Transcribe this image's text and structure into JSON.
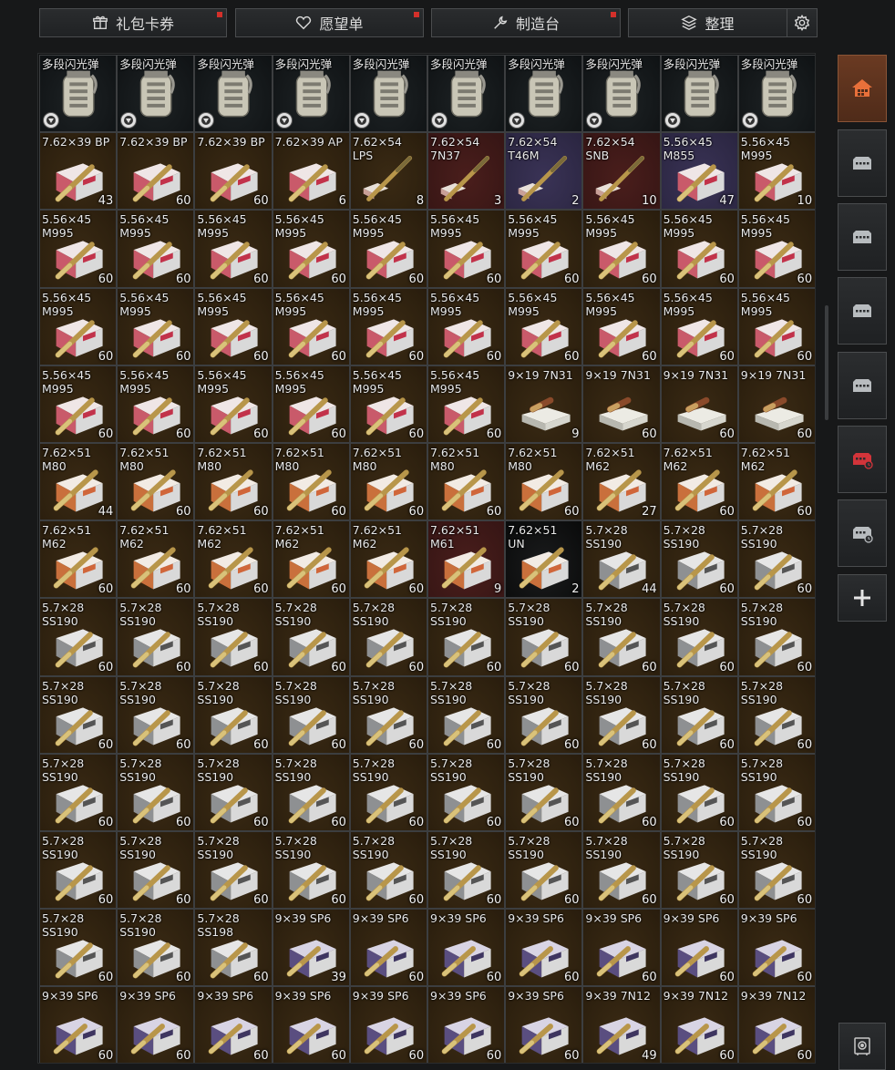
{
  "toolbar": {
    "gift_label": "礼包卡券",
    "wishlist_label": "愿望单",
    "crafting_label": "制造台",
    "sort_label": "整理"
  },
  "colors": {
    "accent_active": "#6a3a22",
    "notify_dot": "#d3302a",
    "cell_default": "#2e210f",
    "cell_red": "#351514",
    "cell_purple": "#2a2540",
    "cell_black": "#090a0a"
  },
  "sidebar": {
    "items": [
      "home-icon",
      "container-icon",
      "container-icon",
      "container-icon",
      "container-icon",
      "red-container-icon",
      "timed-container-icon",
      "plus-icon"
    ],
    "bottom": "safe-icon"
  },
  "stash_rows": [
    [
      {
        "name": "多段闪光弹",
        "count": "",
        "bg": "dark",
        "art": "grenade"
      },
      {
        "name": "多段闪光弹",
        "count": "",
        "bg": "dark",
        "art": "grenade"
      },
      {
        "name": "多段闪光弹",
        "count": "",
        "bg": "dark",
        "art": "grenade"
      },
      {
        "name": "多段闪光弹",
        "count": "",
        "bg": "dark",
        "art": "grenade"
      },
      {
        "name": "多段闪光弹",
        "count": "",
        "bg": "dark",
        "art": "grenade"
      },
      {
        "name": "多段闪光弹",
        "count": "",
        "bg": "dark",
        "art": "grenade"
      },
      {
        "name": "多段闪光弹",
        "count": "",
        "bg": "dark",
        "art": "grenade"
      },
      {
        "name": "多段闪光弹",
        "count": "",
        "bg": "dark",
        "art": "grenade"
      },
      {
        "name": "多段闪光弹",
        "count": "",
        "bg": "dark",
        "art": "grenade"
      },
      {
        "name": "多段闪光弹",
        "count": "",
        "bg": "dark",
        "art": "grenade"
      }
    ],
    [
      {
        "name": "7.62×39 BP",
        "count": "43",
        "bg": "default",
        "art": "ammo-pink"
      },
      {
        "name": "7.62×39 BP",
        "count": "60",
        "bg": "default",
        "art": "ammo-pink"
      },
      {
        "name": "7.62×39 BP",
        "count": "60",
        "bg": "default",
        "art": "ammo-pink"
      },
      {
        "name": "7.62×39 AP",
        "count": "6",
        "bg": "default",
        "art": "ammo-pink"
      },
      {
        "name": "7.62×54\nLPS",
        "count": "8",
        "bg": "default",
        "art": "rifle-round"
      },
      {
        "name": "7.62×54\n7N37",
        "count": "3",
        "bg": "red",
        "art": "rifle-round"
      },
      {
        "name": "7.62×54\nT46M",
        "count": "2",
        "bg": "purple",
        "art": "rifle-round"
      },
      {
        "name": "7.62×54\nSNB",
        "count": "10",
        "bg": "red",
        "art": "rifle-round"
      },
      {
        "name": "5.56×45\nM855",
        "count": "47",
        "bg": "purple",
        "art": "ammo-pink"
      },
      {
        "name": "5.56×45\nM995",
        "count": "10",
        "bg": "default",
        "art": "ammo-pink"
      }
    ],
    [
      {
        "name": "5.56×45\nM995",
        "count": "60",
        "bg": "default",
        "art": "ammo-pink"
      },
      {
        "name": "5.56×45\nM995",
        "count": "60",
        "bg": "default",
        "art": "ammo-pink"
      },
      {
        "name": "5.56×45\nM995",
        "count": "60",
        "bg": "default",
        "art": "ammo-pink"
      },
      {
        "name": "5.56×45\nM995",
        "count": "60",
        "bg": "default",
        "art": "ammo-pink"
      },
      {
        "name": "5.56×45\nM995",
        "count": "60",
        "bg": "default",
        "art": "ammo-pink"
      },
      {
        "name": "5.56×45\nM995",
        "count": "60",
        "bg": "default",
        "art": "ammo-pink"
      },
      {
        "name": "5.56×45\nM995",
        "count": "60",
        "bg": "default",
        "art": "ammo-pink"
      },
      {
        "name": "5.56×45\nM995",
        "count": "60",
        "bg": "default",
        "art": "ammo-pink"
      },
      {
        "name": "5.56×45\nM995",
        "count": "60",
        "bg": "default",
        "art": "ammo-pink"
      },
      {
        "name": "5.56×45\nM995",
        "count": "60",
        "bg": "default",
        "art": "ammo-pink"
      }
    ],
    [
      {
        "name": "5.56×45\nM995",
        "count": "60",
        "bg": "default",
        "art": "ammo-pink"
      },
      {
        "name": "5.56×45\nM995",
        "count": "60",
        "bg": "default",
        "art": "ammo-pink"
      },
      {
        "name": "5.56×45\nM995",
        "count": "60",
        "bg": "default",
        "art": "ammo-pink"
      },
      {
        "name": "5.56×45\nM995",
        "count": "60",
        "bg": "default",
        "art": "ammo-pink"
      },
      {
        "name": "5.56×45\nM995",
        "count": "60",
        "bg": "default",
        "art": "ammo-pink"
      },
      {
        "name": "5.56×45\nM995",
        "count": "60",
        "bg": "default",
        "art": "ammo-pink"
      },
      {
        "name": "5.56×45\nM995",
        "count": "60",
        "bg": "default",
        "art": "ammo-pink"
      },
      {
        "name": "5.56×45\nM995",
        "count": "60",
        "bg": "default",
        "art": "ammo-pink"
      },
      {
        "name": "5.56×45\nM995",
        "count": "60",
        "bg": "default",
        "art": "ammo-pink"
      },
      {
        "name": "5.56×45\nM995",
        "count": "60",
        "bg": "default",
        "art": "ammo-pink"
      }
    ],
    [
      {
        "name": "5.56×45\nM995",
        "count": "60",
        "bg": "default",
        "art": "ammo-pink"
      },
      {
        "name": "5.56×45\nM995",
        "count": "60",
        "bg": "default",
        "art": "ammo-pink"
      },
      {
        "name": "5.56×45\nM995",
        "count": "60",
        "bg": "default",
        "art": "ammo-pink"
      },
      {
        "name": "5.56×45\nM995",
        "count": "60",
        "bg": "default",
        "art": "ammo-pink"
      },
      {
        "name": "5.56×45\nM995",
        "count": "60",
        "bg": "default",
        "art": "ammo-pink"
      },
      {
        "name": "5.56×45\nM995",
        "count": "60",
        "bg": "default",
        "art": "ammo-pink"
      },
      {
        "name": "9×19 7N31",
        "count": "9",
        "bg": "default",
        "art": "pistol-box"
      },
      {
        "name": "9×19 7N31",
        "count": "60",
        "bg": "default",
        "art": "pistol-box"
      },
      {
        "name": "9×19 7N31",
        "count": "60",
        "bg": "default",
        "art": "pistol-box"
      },
      {
        "name": "9×19 7N31",
        "count": "60",
        "bg": "default",
        "art": "pistol-box"
      }
    ],
    [
      {
        "name": "7.62×51\nM80",
        "count": "44",
        "bg": "default",
        "art": "ammo-orange"
      },
      {
        "name": "7.62×51\nM80",
        "count": "60",
        "bg": "default",
        "art": "ammo-orange"
      },
      {
        "name": "7.62×51\nM80",
        "count": "60",
        "bg": "default",
        "art": "ammo-orange"
      },
      {
        "name": "7.62×51\nM80",
        "count": "60",
        "bg": "default",
        "art": "ammo-orange"
      },
      {
        "name": "7.62×51\nM80",
        "count": "60",
        "bg": "default",
        "art": "ammo-orange"
      },
      {
        "name": "7.62×51\nM80",
        "count": "60",
        "bg": "default",
        "art": "ammo-orange"
      },
      {
        "name": "7.62×51\nM80",
        "count": "60",
        "bg": "default",
        "art": "ammo-orange"
      },
      {
        "name": "7.62×51\nM62",
        "count": "27",
        "bg": "default",
        "art": "ammo-orange"
      },
      {
        "name": "7.62×51\nM62",
        "count": "60",
        "bg": "default",
        "art": "ammo-orange"
      },
      {
        "name": "7.62×51\nM62",
        "count": "60",
        "bg": "default",
        "art": "ammo-orange"
      }
    ],
    [
      {
        "name": "7.62×51\nM62",
        "count": "60",
        "bg": "default",
        "art": "ammo-orange"
      },
      {
        "name": "7.62×51\nM62",
        "count": "60",
        "bg": "default",
        "art": "ammo-orange"
      },
      {
        "name": "7.62×51\nM62",
        "count": "60",
        "bg": "default",
        "art": "ammo-orange"
      },
      {
        "name": "7.62×51\nM62",
        "count": "60",
        "bg": "default",
        "art": "ammo-orange"
      },
      {
        "name": "7.62×51\nM62",
        "count": "60",
        "bg": "default",
        "art": "ammo-orange"
      },
      {
        "name": "7.62×51\nM61",
        "count": "9",
        "bg": "red",
        "art": "ammo-orange"
      },
      {
        "name": "7.62×51\nUN",
        "count": "2",
        "bg": "black",
        "art": "ammo-orange"
      },
      {
        "name": "5.7×28\nSS190",
        "count": "44",
        "bg": "default",
        "art": "ammo-gray"
      },
      {
        "name": "5.7×28\nSS190",
        "count": "60",
        "bg": "default",
        "art": "ammo-gray"
      },
      {
        "name": "5.7×28\nSS190",
        "count": "60",
        "bg": "default",
        "art": "ammo-gray"
      }
    ],
    [
      {
        "name": "5.7×28\nSS190",
        "count": "60",
        "bg": "default",
        "art": "ammo-gray"
      },
      {
        "name": "5.7×28\nSS190",
        "count": "60",
        "bg": "default",
        "art": "ammo-gray"
      },
      {
        "name": "5.7×28\nSS190",
        "count": "60",
        "bg": "default",
        "art": "ammo-gray"
      },
      {
        "name": "5.7×28\nSS190",
        "count": "60",
        "bg": "default",
        "art": "ammo-gray"
      },
      {
        "name": "5.7×28\nSS190",
        "count": "60",
        "bg": "default",
        "art": "ammo-gray"
      },
      {
        "name": "5.7×28\nSS190",
        "count": "60",
        "bg": "default",
        "art": "ammo-gray"
      },
      {
        "name": "5.7×28\nSS190",
        "count": "60",
        "bg": "default",
        "art": "ammo-gray"
      },
      {
        "name": "5.7×28\nSS190",
        "count": "60",
        "bg": "default",
        "art": "ammo-gray"
      },
      {
        "name": "5.7×28\nSS190",
        "count": "60",
        "bg": "default",
        "art": "ammo-gray"
      },
      {
        "name": "5.7×28\nSS190",
        "count": "60",
        "bg": "default",
        "art": "ammo-gray"
      }
    ],
    [
      {
        "name": "5.7×28\nSS190",
        "count": "60",
        "bg": "default",
        "art": "ammo-gray"
      },
      {
        "name": "5.7×28\nSS190",
        "count": "60",
        "bg": "default",
        "art": "ammo-gray"
      },
      {
        "name": "5.7×28\nSS190",
        "count": "60",
        "bg": "default",
        "art": "ammo-gray"
      },
      {
        "name": "5.7×28\nSS190",
        "count": "60",
        "bg": "default",
        "art": "ammo-gray"
      },
      {
        "name": "5.7×28\nSS190",
        "count": "60",
        "bg": "default",
        "art": "ammo-gray"
      },
      {
        "name": "5.7×28\nSS190",
        "count": "60",
        "bg": "default",
        "art": "ammo-gray"
      },
      {
        "name": "5.7×28\nSS190",
        "count": "60",
        "bg": "default",
        "art": "ammo-gray"
      },
      {
        "name": "5.7×28\nSS190",
        "count": "60",
        "bg": "default",
        "art": "ammo-gray"
      },
      {
        "name": "5.7×28\nSS190",
        "count": "60",
        "bg": "default",
        "art": "ammo-gray"
      },
      {
        "name": "5.7×28\nSS190",
        "count": "60",
        "bg": "default",
        "art": "ammo-gray"
      }
    ],
    [
      {
        "name": "5.7×28\nSS190",
        "count": "60",
        "bg": "default",
        "art": "ammo-gray"
      },
      {
        "name": "5.7×28\nSS190",
        "count": "60",
        "bg": "default",
        "art": "ammo-gray"
      },
      {
        "name": "5.7×28\nSS190",
        "count": "60",
        "bg": "default",
        "art": "ammo-gray"
      },
      {
        "name": "5.7×28\nSS190",
        "count": "60",
        "bg": "default",
        "art": "ammo-gray"
      },
      {
        "name": "5.7×28\nSS190",
        "count": "60",
        "bg": "default",
        "art": "ammo-gray"
      },
      {
        "name": "5.7×28\nSS190",
        "count": "60",
        "bg": "default",
        "art": "ammo-gray"
      },
      {
        "name": "5.7×28\nSS190",
        "count": "60",
        "bg": "default",
        "art": "ammo-gray"
      },
      {
        "name": "5.7×28\nSS190",
        "count": "60",
        "bg": "default",
        "art": "ammo-gray"
      },
      {
        "name": "5.7×28\nSS190",
        "count": "60",
        "bg": "default",
        "art": "ammo-gray"
      },
      {
        "name": "5.7×28\nSS190",
        "count": "60",
        "bg": "default",
        "art": "ammo-gray"
      }
    ],
    [
      {
        "name": "5.7×28\nSS190",
        "count": "60",
        "bg": "default",
        "art": "ammo-gray"
      },
      {
        "name": "5.7×28\nSS190",
        "count": "60",
        "bg": "default",
        "art": "ammo-gray"
      },
      {
        "name": "5.7×28\nSS190",
        "count": "60",
        "bg": "default",
        "art": "ammo-gray"
      },
      {
        "name": "5.7×28\nSS190",
        "count": "60",
        "bg": "default",
        "art": "ammo-gray"
      },
      {
        "name": "5.7×28\nSS190",
        "count": "60",
        "bg": "default",
        "art": "ammo-gray"
      },
      {
        "name": "5.7×28\nSS190",
        "count": "60",
        "bg": "default",
        "art": "ammo-gray"
      },
      {
        "name": "5.7×28\nSS190",
        "count": "60",
        "bg": "default",
        "art": "ammo-gray"
      },
      {
        "name": "5.7×28\nSS190",
        "count": "60",
        "bg": "default",
        "art": "ammo-gray"
      },
      {
        "name": "5.7×28\nSS190",
        "count": "60",
        "bg": "default",
        "art": "ammo-gray"
      },
      {
        "name": "5.7×28\nSS190",
        "count": "60",
        "bg": "default",
        "art": "ammo-gray"
      }
    ],
    [
      {
        "name": "5.7×28\nSS190",
        "count": "60",
        "bg": "default",
        "art": "ammo-gray"
      },
      {
        "name": "5.7×28\nSS190",
        "count": "60",
        "bg": "default",
        "art": "ammo-gray"
      },
      {
        "name": "5.7×28\nSS198",
        "count": "60",
        "bg": "default",
        "art": "ammo-gray"
      },
      {
        "name": "9×39 SP6",
        "count": "39",
        "bg": "default",
        "art": "ammo-purple"
      },
      {
        "name": "9×39 SP6",
        "count": "60",
        "bg": "default",
        "art": "ammo-purple"
      },
      {
        "name": "9×39 SP6",
        "count": "60",
        "bg": "default",
        "art": "ammo-purple"
      },
      {
        "name": "9×39 SP6",
        "count": "60",
        "bg": "default",
        "art": "ammo-purple"
      },
      {
        "name": "9×39 SP6",
        "count": "60",
        "bg": "default",
        "art": "ammo-purple"
      },
      {
        "name": "9×39 SP6",
        "count": "60",
        "bg": "default",
        "art": "ammo-purple"
      },
      {
        "name": "9×39 SP6",
        "count": "60",
        "bg": "default",
        "art": "ammo-purple"
      }
    ],
    [
      {
        "name": "9×39 SP6",
        "count": "60",
        "bg": "default",
        "art": "ammo-purple"
      },
      {
        "name": "9×39 SP6",
        "count": "60",
        "bg": "default",
        "art": "ammo-purple"
      },
      {
        "name": "9×39 SP6",
        "count": "60",
        "bg": "default",
        "art": "ammo-purple"
      },
      {
        "name": "9×39 SP6",
        "count": "60",
        "bg": "default",
        "art": "ammo-purple"
      },
      {
        "name": "9×39 SP6",
        "count": "60",
        "bg": "default",
        "art": "ammo-purple"
      },
      {
        "name": "9×39 SP6",
        "count": "60",
        "bg": "default",
        "art": "ammo-purple"
      },
      {
        "name": "9×39 SP6",
        "count": "60",
        "bg": "default",
        "art": "ammo-purple"
      },
      {
        "name": "9×39 7N12",
        "count": "49",
        "bg": "default",
        "art": "ammo-purple"
      },
      {
        "name": "9×39 7N12",
        "count": "60",
        "bg": "default",
        "art": "ammo-purple"
      },
      {
        "name": "9×39 7N12",
        "count": "60",
        "bg": "default",
        "art": "ammo-purple"
      }
    ]
  ]
}
